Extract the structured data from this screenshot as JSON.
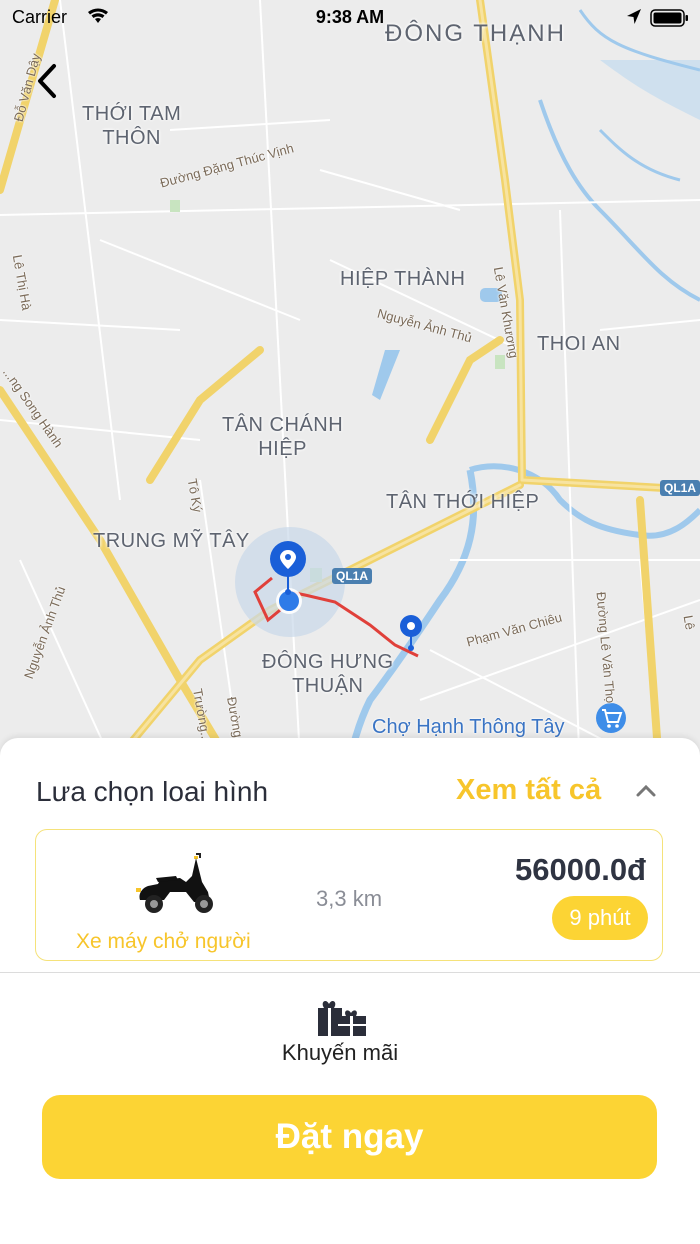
{
  "status_bar": {
    "carrier": "Carrier",
    "time": "9:38 AM"
  },
  "map": {
    "areas": [
      {
        "id": "dong-thanh",
        "text": "ĐÔNG THẠNH"
      },
      {
        "id": "thoi-tam-thon",
        "text": "THỚI TAM\nTHÔN"
      },
      {
        "id": "hiep-thanh",
        "text": "HIỆP THÀNH"
      },
      {
        "id": "thoi-an",
        "text": "THOI AN"
      },
      {
        "id": "tan-chanh-hiep",
        "text": "TÂN CHÁNH\nHIỆP"
      },
      {
        "id": "tan-thoi-hiep",
        "text": "TÂN THỚI HIỆP"
      },
      {
        "id": "trung-my-tay",
        "text": "TRUNG MỸ TÂY"
      },
      {
        "id": "dong-hung-thuan",
        "text": "ĐÔNG HƯNG\nTHUẬN"
      }
    ],
    "roads": [
      {
        "id": "do-van-day",
        "text": "Đỗ Văn Dậy"
      },
      {
        "id": "dang-thuc-vinh",
        "text": "Đường Đặng Thúc Vịnh"
      },
      {
        "id": "le-van-khuong",
        "text": "Lê Văn Khương"
      },
      {
        "id": "nguyen-anh-thu-1",
        "text": "Nguyễn Ảnh Thủ"
      },
      {
        "id": "le-thi-ha",
        "text": "Lê Thị Hà"
      },
      {
        "id": "song-hanh",
        "text": "...ng Song Hành"
      },
      {
        "id": "to-ky",
        "text": "Tô Ký"
      },
      {
        "id": "nguyen-anh-thu-2",
        "text": "Nguyễn Ảnh Thủ"
      },
      {
        "id": "pham-van-chieu",
        "text": "Phạm Văn Chiêu"
      },
      {
        "id": "le-van-tho",
        "text": "Đường Lê Văn Thọ"
      },
      {
        "id": "truong",
        "text": "Trường..."
      },
      {
        "id": "duong",
        "text": "Đường..."
      },
      {
        "id": "le-right",
        "text": "Lê"
      }
    ],
    "shields": [
      "QL1A",
      "QL1A"
    ],
    "poi": "Chợ Hạnh Thông Tây",
    "route_color": "#e0403a",
    "pin_color": "#1a5fd8"
  },
  "sheet": {
    "title": "Lưa chọn loai hình",
    "see_all": "Xem tất cả",
    "vehicle": {
      "name": "Xe máy chở người",
      "distance": "3,3 km",
      "price": "56000.0đ",
      "eta": "9 phút",
      "icon": "scooter-icon"
    },
    "promo_label": "Khuyến mãi",
    "book_button": "Đặt ngay",
    "accent_color": "#fcd434"
  }
}
